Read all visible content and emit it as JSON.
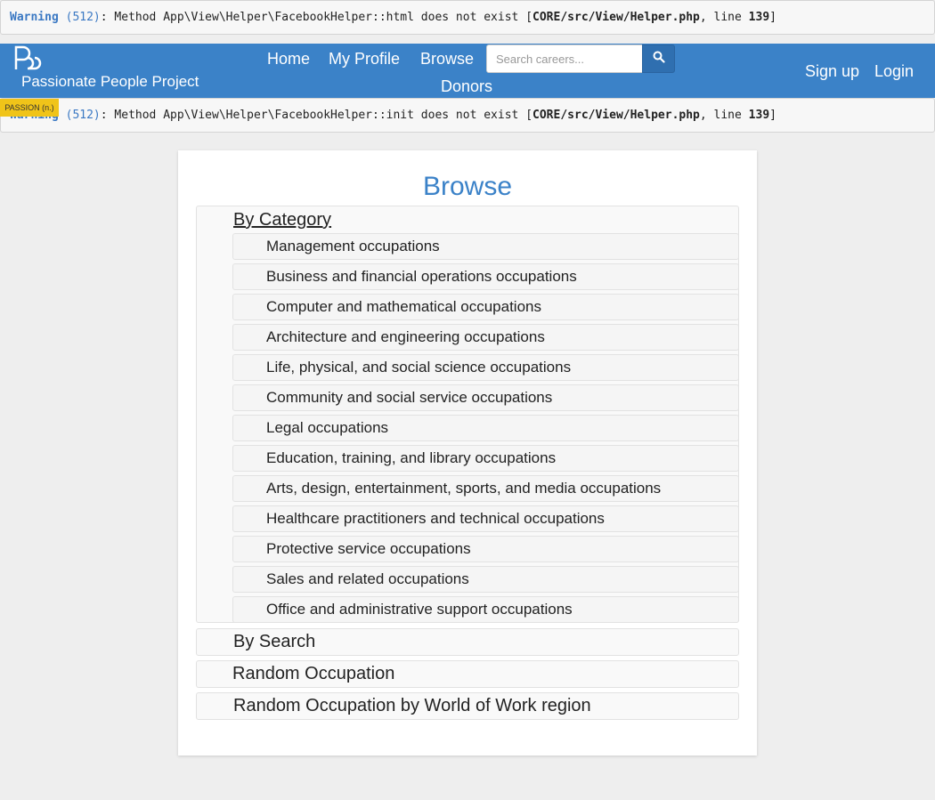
{
  "warnings": [
    {
      "label": "Warning",
      "code": "(512)",
      "message": ": Method App\\View\\Helper\\FacebookHelper::html does not exist [",
      "file": "CORE/src/View/Helper.php",
      "line_prefix": ", line ",
      "line": "139",
      "suffix": "]"
    },
    {
      "label": "Warning",
      "code": "(512)",
      "message": ": Method App\\View\\Helper\\FacebookHelper::init does not exist [",
      "file": "CORE/src/View/Helper.php",
      "line_prefix": ", line ",
      "line": "139",
      "suffix": "]"
    }
  ],
  "navbar": {
    "brand": "Passionate People Project",
    "badge": "PASSION (n.)",
    "links": {
      "home": "Home",
      "profile": "My Profile",
      "browse": "Browse",
      "donors": "Donors"
    },
    "search": {
      "placeholder": "Search careers...",
      "value": ""
    },
    "search_icon": "search-icon",
    "signup": "Sign up",
    "login": "Login",
    "color": "#3b82c8"
  },
  "main": {
    "title": "Browse",
    "by_category": "By Category",
    "categories": [
      "Management occupations",
      "Business and financial operations occupations",
      "Computer and mathematical occupations",
      "Architecture and engineering occupations",
      "Life, physical, and social science occupations",
      "Community and social service occupations",
      "Legal occupations",
      "Education, training, and library occupations",
      "Arts, design, entertainment, sports, and media occupations",
      "Healthcare practitioners and technical occupations",
      "Protective service occupations",
      "Sales and related occupations",
      "Office and administrative support occupations"
    ],
    "by_search": "By Search",
    "random": "Random Occupation",
    "random_region": "Random Occupation by World of Work region"
  }
}
